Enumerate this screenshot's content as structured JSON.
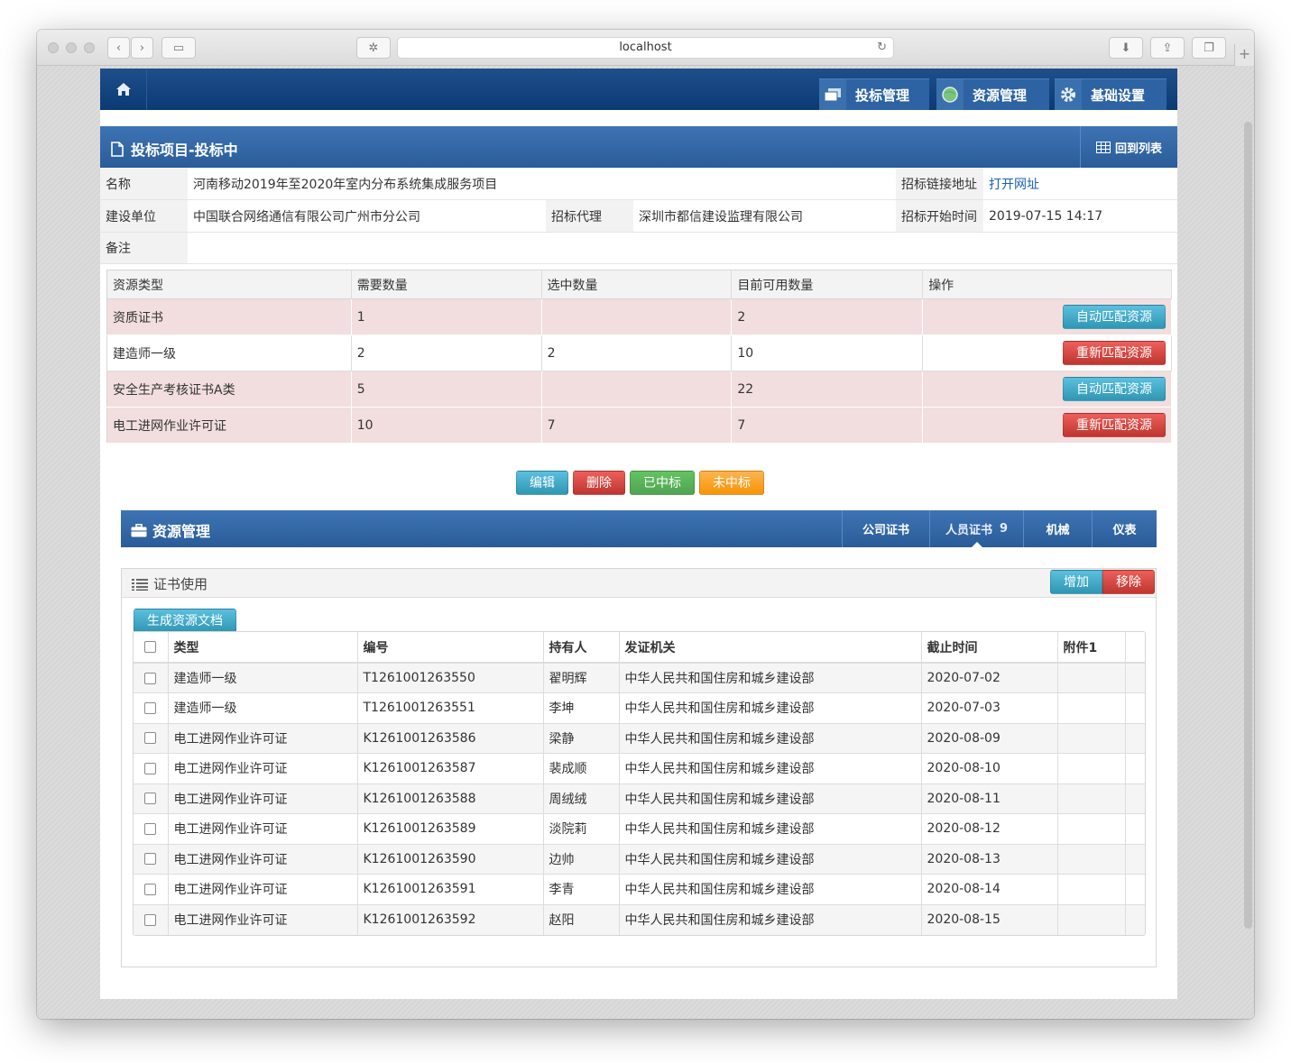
{
  "browser": {
    "url": "localhost"
  },
  "topnav": {
    "home_icon": "home-icon",
    "tabs": [
      {
        "label": "投标管理",
        "icon": "window-stack-icon"
      },
      {
        "label": "资源管理",
        "icon": "globe-icon"
      },
      {
        "label": "基础设置",
        "icon": "gear-icon"
      }
    ]
  },
  "panel": {
    "title": "投标项目-投标中",
    "back_label": "回到列表"
  },
  "info": {
    "name_label": "名称",
    "name_value": "河南移动2019年至2020年室内分布系统集成服务项目",
    "link_label": "招标链接地址",
    "link_value": "打开网址",
    "builder_label": "建设单位",
    "builder_value": "中国联合网络通信有限公司广州市分公司",
    "agent_label": "招标代理",
    "agent_value": "深圳市都信建设监理有限公司",
    "start_label": "招标开始时间",
    "start_value": "2019-07-15 14:17",
    "remark_label": "备注",
    "remark_value": ""
  },
  "requirements": {
    "headers": [
      "资源类型",
      "需要数量",
      "选中数量",
      "目前可用数量",
      "操作"
    ],
    "rows": [
      {
        "type": "资质证书",
        "need": "1",
        "selected": "",
        "available": "2",
        "action": "自动匹配资源"
      },
      {
        "type": "建造师一级",
        "need": "2",
        "selected": "2",
        "available": "10",
        "action": "重新匹配资源"
      },
      {
        "type": "安全生产考核证书A类",
        "need": "5",
        "selected": "",
        "available": "22",
        "action": "自动匹配资源"
      },
      {
        "type": "电工进网作业许可证",
        "need": "10",
        "selected": "7",
        "available": "7",
        "action": "重新匹配资源"
      }
    ]
  },
  "actions": {
    "edit": "编辑",
    "delete": "删除",
    "won": "已中标",
    "lost": "未中标"
  },
  "resources": {
    "title": "资源管理",
    "tabs": [
      {
        "label": "公司证书",
        "badge": ""
      },
      {
        "label": "人员证书",
        "badge": "9"
      },
      {
        "label": "机械",
        "badge": ""
      },
      {
        "label": "仪表",
        "badge": ""
      }
    ]
  },
  "certs": {
    "title": "证书使用",
    "add": "增加",
    "remove": "移除",
    "generate": "生成资源文档",
    "headers": [
      "类型",
      "编号",
      "持有人",
      "发证机关",
      "截止时间",
      "附件1"
    ],
    "rows": [
      {
        "type": "建造师一级",
        "no": "T1261001263550",
        "holder": "翟明辉",
        "issuer": "中华人民共和国住房和城乡建设部",
        "expiry": "2020-07-02",
        "att": ""
      },
      {
        "type": "建造师一级",
        "no": "T1261001263551",
        "holder": "李坤",
        "issuer": "中华人民共和国住房和城乡建设部",
        "expiry": "2020-07-03",
        "att": ""
      },
      {
        "type": "电工进网作业许可证",
        "no": "K1261001263586",
        "holder": "梁静",
        "issuer": "中华人民共和国住房和城乡建设部",
        "expiry": "2020-08-09",
        "att": ""
      },
      {
        "type": "电工进网作业许可证",
        "no": "K1261001263587",
        "holder": "裴成顺",
        "issuer": "中华人民共和国住房和城乡建设部",
        "expiry": "2020-08-10",
        "att": ""
      },
      {
        "type": "电工进网作业许可证",
        "no": "K1261001263588",
        "holder": "周绒绒",
        "issuer": "中华人民共和国住房和城乡建设部",
        "expiry": "2020-08-11",
        "att": ""
      },
      {
        "type": "电工进网作业许可证",
        "no": "K1261001263589",
        "holder": "淡院莉",
        "issuer": "中华人民共和国住房和城乡建设部",
        "expiry": "2020-08-12",
        "att": ""
      },
      {
        "type": "电工进网作业许可证",
        "no": "K1261001263590",
        "holder": "边帅",
        "issuer": "中华人民共和国住房和城乡建设部",
        "expiry": "2020-08-13",
        "att": ""
      },
      {
        "type": "电工进网作业许可证",
        "no": "K1261001263591",
        "holder": "李青",
        "issuer": "中华人民共和国住房和城乡建设部",
        "expiry": "2020-08-14",
        "att": ""
      },
      {
        "type": "电工进网作业许可证",
        "no": "K1261001263592",
        "holder": "赵阳",
        "issuer": "中华人民共和国住房和城乡建设部",
        "expiry": "2020-08-15",
        "att": ""
      }
    ]
  }
}
